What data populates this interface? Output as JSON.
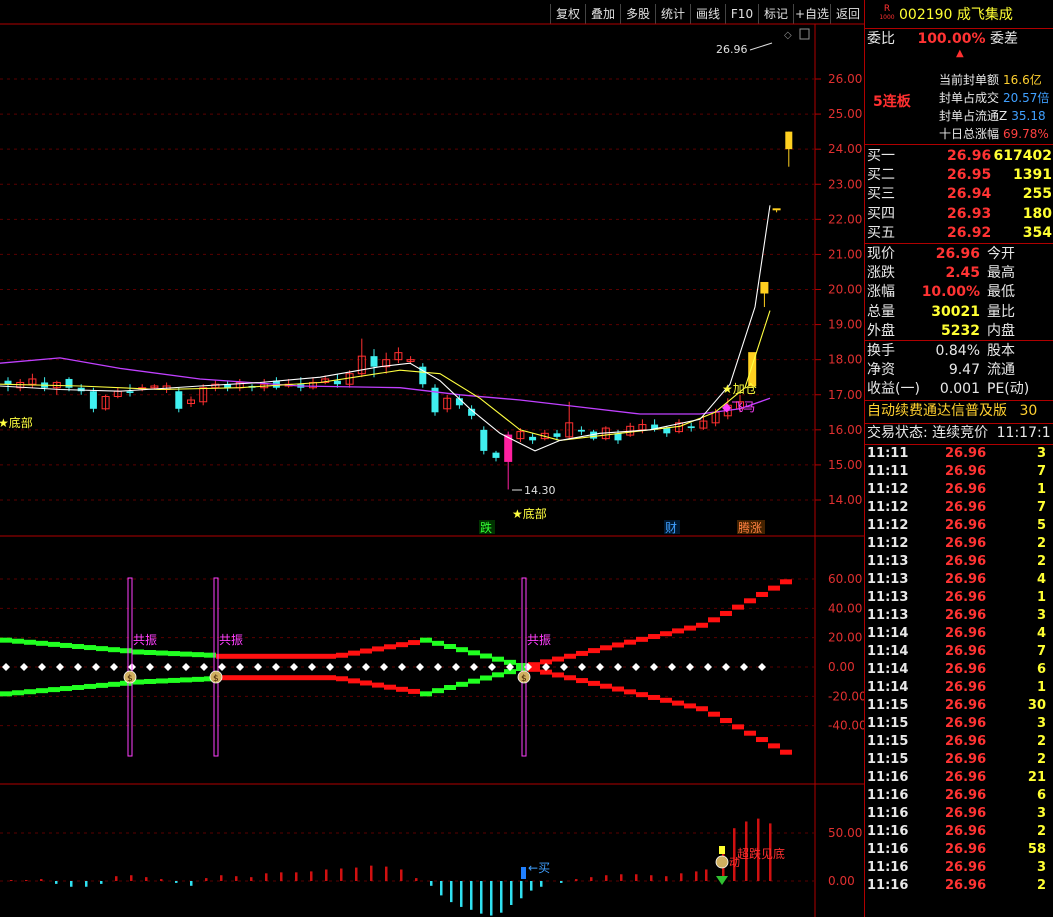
{
  "toolbar": {
    "buttons": [
      "复权",
      "叠加",
      "多股",
      "统计",
      "画线",
      "F10",
      "标记",
      "+自选",
      "返回"
    ]
  },
  "main_chart": {
    "price_axis": [
      "26.00",
      "25.00",
      "24.00",
      "23.00",
      "22.00",
      "21.00",
      "20.00",
      "19.00",
      "18.00",
      "17.00",
      "16.00",
      "15.00",
      "14.00"
    ],
    "high_label": "26.96",
    "low_label": "14.30",
    "bottom_label_left": "★底部",
    "bottom_label_mid": "★底部",
    "signal_jia_cang": "加仓",
    "signal_fei_ma": "飞马",
    "event_tags": {
      "die": "跌",
      "cai": "财",
      "teng_zhang": "腾涨"
    }
  },
  "indicator1": {
    "axis": [
      "60.00",
      "40.00",
      "20.00",
      "0.00",
      "-20.00",
      "-40.00"
    ],
    "gong_zhen": [
      "共振",
      "共振",
      "共振"
    ],
    "money_icon": "$"
  },
  "indicator2": {
    "axis": [
      "50.00",
      "0.00"
    ],
    "buy_label": "买",
    "bottom_label": "超跌见底",
    "qi_dong": "动"
  },
  "side": {
    "code": "002190",
    "name": "成飞集成",
    "badge_top": "R",
    "badge_bottom": "1000",
    "weibi_label": "委比",
    "weibi_value": "100.00%",
    "weicha_label": "委差",
    "lianban": "5连板",
    "seal_rows": [
      {
        "label": "当前封单额",
        "value": "16.6亿"
      },
      {
        "label": "封单占成交",
        "value": "20.57倍"
      },
      {
        "label": "封单占流通Z",
        "value": "35.18"
      },
      {
        "label": "十日总涨幅",
        "value": "69.78%"
      }
    ],
    "bids": [
      {
        "label": "买一",
        "price": "26.96",
        "vol": "617402"
      },
      {
        "label": "买二",
        "price": "26.95",
        "vol": "1391"
      },
      {
        "label": "买三",
        "price": "26.94",
        "vol": "255"
      },
      {
        "label": "买四",
        "price": "26.93",
        "vol": "180"
      },
      {
        "label": "买五",
        "price": "26.92",
        "vol": "354"
      }
    ],
    "quote": [
      {
        "l1": "现价",
        "v1": "26.96",
        "l2": "今开"
      },
      {
        "l1": "涨跌",
        "v1": "2.45",
        "l2": "最高"
      },
      {
        "l1": "涨幅",
        "v1": "10.00%",
        "l2": "最低"
      },
      {
        "l1": "总量",
        "v1": "30021",
        "l2": "量比"
      },
      {
        "l1": "外盘",
        "v1": "5232",
        "l2": "内盘"
      }
    ],
    "stats": [
      {
        "l1": "换手",
        "v1": "0.84%",
        "l2": "股本"
      },
      {
        "l1": "净资",
        "v1": "9.47",
        "l2": "流通"
      },
      {
        "l1": "收益(一)",
        "v1": "0.001",
        "l2": "PE(动)"
      }
    ],
    "banner": "自动续费通达信普及版",
    "banner_num": "30",
    "trade_status_label": "交易状态: 连续竞价",
    "trade_status_time": "11:17:1",
    "ticks": [
      {
        "t": "11:11",
        "p": "26.96",
        "v": "3"
      },
      {
        "t": "11:11",
        "p": "26.96",
        "v": "7"
      },
      {
        "t": "11:12",
        "p": "26.96",
        "v": "1"
      },
      {
        "t": "11:12",
        "p": "26.96",
        "v": "7"
      },
      {
        "t": "11:12",
        "p": "26.96",
        "v": "5"
      },
      {
        "t": "11:12",
        "p": "26.96",
        "v": "2"
      },
      {
        "t": "11:13",
        "p": "26.96",
        "v": "2"
      },
      {
        "t": "11:13",
        "p": "26.96",
        "v": "4"
      },
      {
        "t": "11:13",
        "p": "26.96",
        "v": "1"
      },
      {
        "t": "11:13",
        "p": "26.96",
        "v": "3"
      },
      {
        "t": "11:14",
        "p": "26.96",
        "v": "4"
      },
      {
        "t": "11:14",
        "p": "26.96",
        "v": "7"
      },
      {
        "t": "11:14",
        "p": "26.96",
        "v": "6"
      },
      {
        "t": "11:14",
        "p": "26.96",
        "v": "1"
      },
      {
        "t": "11:15",
        "p": "26.96",
        "v": "30"
      },
      {
        "t": "11:15",
        "p": "26.96",
        "v": "3"
      },
      {
        "t": "11:15",
        "p": "26.96",
        "v": "2"
      },
      {
        "t": "11:15",
        "p": "26.96",
        "v": "2"
      },
      {
        "t": "11:16",
        "p": "26.96",
        "v": "21"
      },
      {
        "t": "11:16",
        "p": "26.96",
        "v": "6"
      },
      {
        "t": "11:16",
        "p": "26.96",
        "v": "3"
      },
      {
        "t": "11:16",
        "p": "26.96",
        "v": "2"
      },
      {
        "t": "11:16",
        "p": "26.96",
        "v": "58"
      },
      {
        "t": "11:16",
        "p": "26.96",
        "v": "3"
      },
      {
        "t": "11:16",
        "p": "26.96",
        "v": "2"
      }
    ]
  }
}
